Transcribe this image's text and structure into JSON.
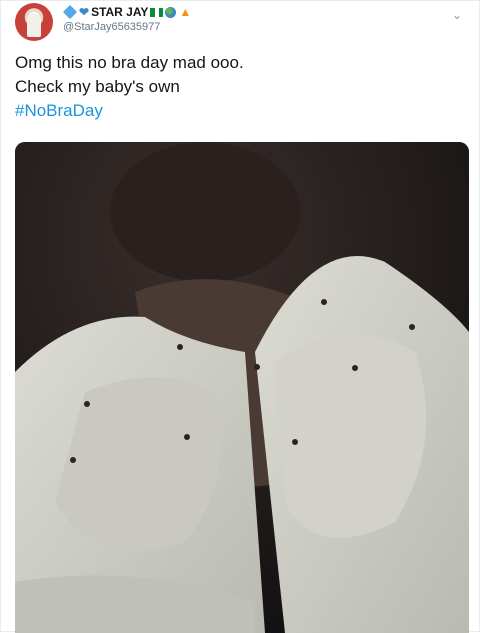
{
  "tweet": {
    "display_name": "STAR JAY",
    "handle": "@StarJay65635977",
    "text_line1": "Omg this no bra day mad ooo.",
    "text_line2": "Check my baby's own",
    "hashtag": "#NoBraDay",
    "more_icon": "chevron-down-icon",
    "emojis": [
      "gem-icon",
      "blue-heart-icon",
      "nigeria-flag-icon",
      "globe-icon",
      "fire-icon"
    ]
  },
  "colors": {
    "hashtag": "#1b95e0",
    "handle": "#657786",
    "text": "#14171a"
  }
}
